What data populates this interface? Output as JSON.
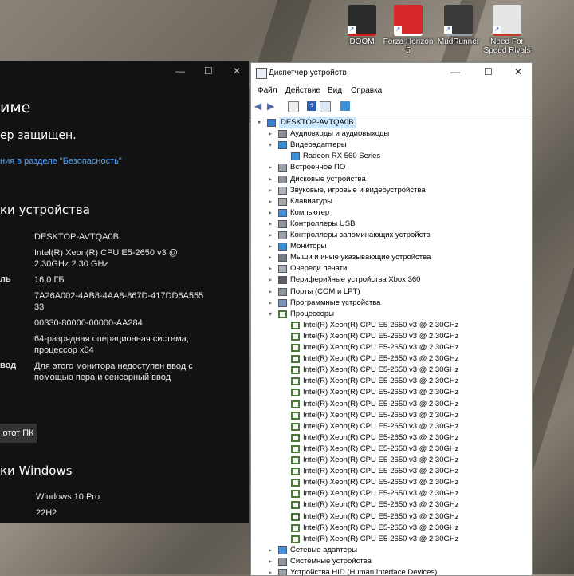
{
  "desktop": {
    "icons": [
      {
        "label": "DOOM",
        "color": "#2a2a2a",
        "accent": "#d11f1f"
      },
      {
        "label": "Forza Horizon 5",
        "color": "#d62828",
        "accent": "#ffffff"
      },
      {
        "label": "MudRunner",
        "color": "#3a3a3a",
        "accent": "#9aa0a6"
      },
      {
        "label": "Need For Speed Rivals",
        "color": "#e6e6e6",
        "accent": "#c0392b"
      }
    ]
  },
  "settings": {
    "title_fragment": "име",
    "protected_text": "ер защищен.",
    "security_link": "ния в разделе \"Безопасность\"",
    "device_specs_heading": "ки устройства",
    "specs": [
      {
        "label": "",
        "value": "DESKTOP-AVTQA0B"
      },
      {
        "label": "",
        "value": "Intel(R) Xeon(R) CPU E5-2650 v3 @ 2.30GHz   2.30 GHz"
      },
      {
        "label": "ль",
        "value": "16,0 ГБ"
      },
      {
        "label": "",
        "value": "7A26A002-4AB8-4AA8-867D-417DD6A555 33"
      },
      {
        "label": "",
        "value": "00330-80000-00000-AA284"
      },
      {
        "label": "",
        "value": "64-разрядная операционная система, процессор x64"
      },
      {
        "label": "вод",
        "value": "Для этого монитора недоступен ввод с помощью пера и сенсорный ввод"
      }
    ],
    "rename_button": "отот ПК",
    "windows_specs_heading": "ки Windows",
    "windows_specs": [
      {
        "value": "Windows 10 Pro"
      },
      {
        "value": "22H2"
      }
    ]
  },
  "device_manager": {
    "title": "Диспетчер устройств",
    "menu": [
      "Файл",
      "Действие",
      "Вид",
      "Справка"
    ],
    "root": "DESKTOP-AVTQA0B",
    "categories_before_gpu": [
      {
        "label": "Аудиовходы и аудиовыходы",
        "icon": "speaker-icon"
      }
    ],
    "gpu_category": "Видеоадаптеры",
    "gpu_children": [
      "Radeon RX 560 Series"
    ],
    "categories_middle": [
      {
        "label": "Встроенное ПО",
        "icon": "firmware-icon"
      },
      {
        "label": "Дисковые устройства",
        "icon": "disk-icon"
      },
      {
        "label": "Звуковые, игровые и видеоустройства",
        "icon": "sound-icon"
      },
      {
        "label": "Клавиатуры",
        "icon": "keyboard-icon"
      },
      {
        "label": "Компьютер",
        "icon": "computer-icon"
      },
      {
        "label": "Контроллеры USB",
        "icon": "usb-icon"
      },
      {
        "label": "Контроллеры запоминающих устройств",
        "icon": "storage-icon"
      },
      {
        "label": "Мониторы",
        "icon": "monitor-icon"
      },
      {
        "label": "Мыши и иные указывающие устройства",
        "icon": "mouse-icon"
      },
      {
        "label": "Очереди печати",
        "icon": "printer-icon"
      },
      {
        "label": "Периферийные устройства Xbox 360",
        "icon": "gamepad-icon"
      },
      {
        "label": "Порты (COM и LPT)",
        "icon": "port-icon"
      },
      {
        "label": "Программные устройства",
        "icon": "software-icon"
      }
    ],
    "cpu_category": "Процессоры",
    "cpu_children": [
      "Intel(R) Xeon(R) CPU E5-2650 v3 @ 2.30GHz",
      "Intel(R) Xeon(R) CPU E5-2650 v3 @ 2.30GHz",
      "Intel(R) Xeon(R) CPU E5-2650 v3 @ 2.30GHz",
      "Intel(R) Xeon(R) CPU E5-2650 v3 @ 2.30GHz",
      "Intel(R) Xeon(R) CPU E5-2650 v3 @ 2.30GHz",
      "Intel(R) Xeon(R) CPU E5-2650 v3 @ 2.30GHz",
      "Intel(R) Xeon(R) CPU E5-2650 v3 @ 2.30GHz",
      "Intel(R) Xeon(R) CPU E5-2650 v3 @ 2.30GHz",
      "Intel(R) Xeon(R) CPU E5-2650 v3 @ 2.30GHz",
      "Intel(R) Xeon(R) CPU E5-2650 v3 @ 2.30GHz",
      "Intel(R) Xeon(R) CPU E5-2650 v3 @ 2.30GHz",
      "Intel(R) Xeon(R) CPU E5-2650 v3 @ 2.30GHz",
      "Intel(R) Xeon(R) CPU E5-2650 v3 @ 2.30GHz",
      "Intel(R) Xeon(R) CPU E5-2650 v3 @ 2.30GHz",
      "Intel(R) Xeon(R) CPU E5-2650 v3 @ 2.30GHz",
      "Intel(R) Xeon(R) CPU E5-2650 v3 @ 2.30GHz",
      "Intel(R) Xeon(R) CPU E5-2650 v3 @ 2.30GHz",
      "Intel(R) Xeon(R) CPU E5-2650 v3 @ 2.30GHz",
      "Intel(R) Xeon(R) CPU E5-2650 v3 @ 2.30GHz",
      "Intel(R) Xeon(R) CPU E5-2650 v3 @ 2.30GHz"
    ],
    "categories_after_cpu": [
      {
        "label": "Сетевые адаптеры",
        "icon": "network-icon"
      },
      {
        "label": "Системные устройства",
        "icon": "system-icon"
      },
      {
        "label": "Устройства HID (Human Interface Devices)",
        "icon": "hid-icon"
      }
    ]
  }
}
